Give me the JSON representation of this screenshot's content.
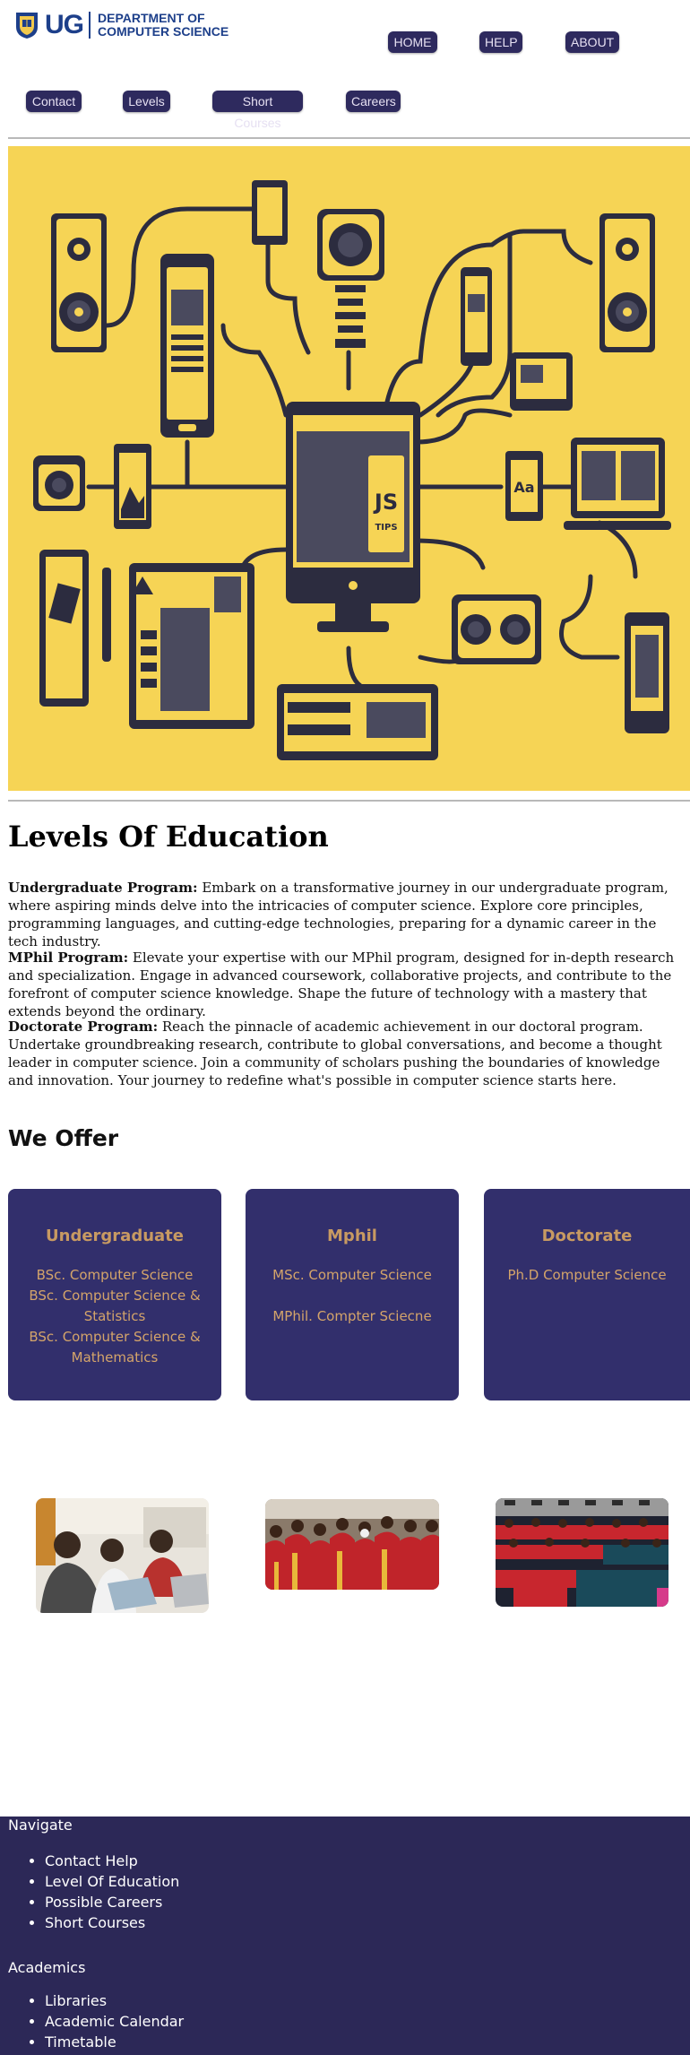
{
  "header": {
    "logo_abbr": "UG",
    "logo_line1": "DEPARTMENT OF",
    "logo_line2": "COMPUTER SCIENCE"
  },
  "nav": {
    "home": "HOME",
    "help": "HELP",
    "about": "ABOUT",
    "contact": "Contact",
    "levels": "Levels",
    "short_courses": "Short Courses",
    "careers": "Careers"
  },
  "hero": {
    "screen_text": "JS",
    "screen_subtext": "TIPS",
    "device_label": "Aa"
  },
  "levels": {
    "title": "Levels Of Education",
    "programs": [
      {
        "name": "Undergraduate Program:",
        "text": " Embark on a transformative journey in our undergraduate program, where aspiring minds delve into the intricacies of computer science. Explore core principles, programming languages, and cutting-edge technologies, preparing for a dynamic career in the tech industry."
      },
      {
        "name": "MPhil Program:",
        "text": " Elevate your expertise with our MPhil program, designed for in-depth research and specialization. Engage in advanced coursework, collaborative projects, and contribute to the forefront of computer science knowledge. Shape the future of technology with a mastery that extends beyond the ordinary."
      },
      {
        "name": "Doctorate Program:",
        "text": " Reach the pinnacle of academic achievement in our doctoral program. Undertake groundbreaking research, contribute to global conversations, and become a thought leader in computer science. Join a community of scholars pushing the boundaries of knowledge and innovation. Your journey to redefine what's possible in computer science starts here."
      }
    ]
  },
  "offer": {
    "title": "We Offer",
    "cards": [
      {
        "title": "Undergraduate",
        "items": [
          "BSc. Computer Science",
          "BSc. Computer Science & Statistics",
          "BSc. Computer Science & Mathematics"
        ]
      },
      {
        "title": "Mphil",
        "items": [
          "MSc. Computer Science",
          "MPhil. Compter Sciecne"
        ]
      },
      {
        "title": "Doctorate",
        "items": [
          "Ph.D Computer Science"
        ]
      }
    ]
  },
  "footer": {
    "navigate_heading": "Navigate",
    "navigate_links": [
      "Contact Help",
      "Level Of Education",
      "Possible Careers",
      "Short Courses"
    ],
    "academics_heading": "Academics",
    "academics_links": [
      "Libraries",
      "Academic Calendar",
      "Timetable"
    ]
  },
  "colors": {
    "brand_blue": "#1d3f8a",
    "button_bg": "#2e2a5e",
    "card_bg": "#322f6c",
    "card_text": "#d4a46a",
    "hero_bg": "#f6d455",
    "footer_bg": "#2c2857"
  }
}
